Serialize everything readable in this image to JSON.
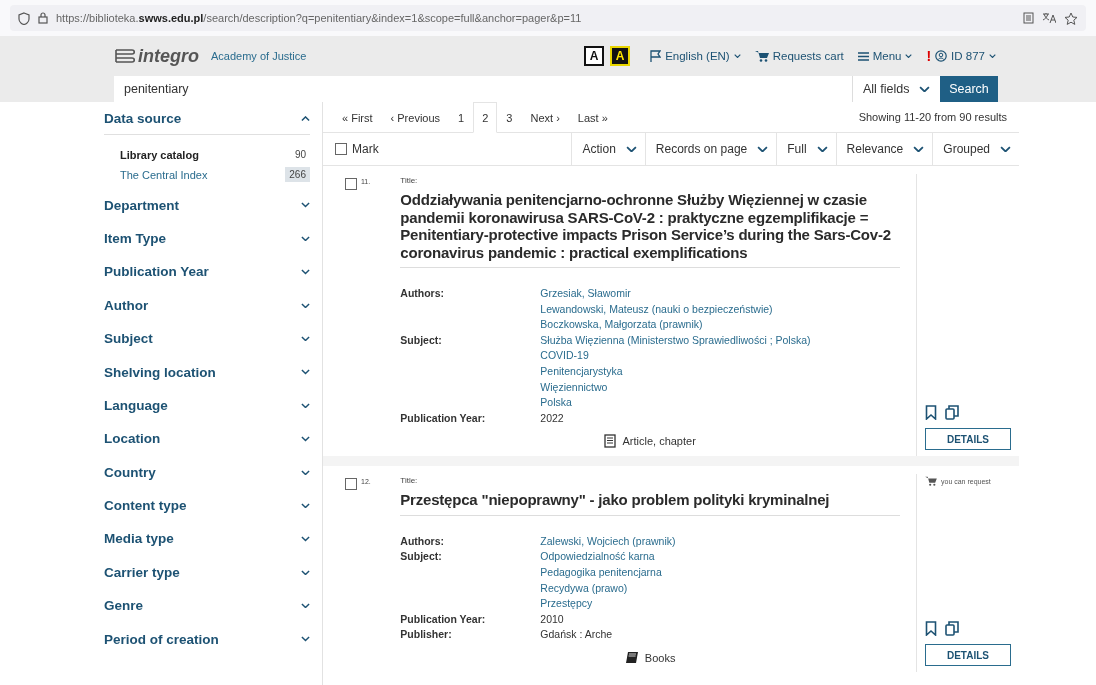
{
  "browser": {
    "url": "https://biblioteka.**swws.edu.pl**/search/description?q=penitentiary&index=1&scope=full&anchor=pager&p=11"
  },
  "header": {
    "logo": "integro",
    "library": "Academy of Justice",
    "contrast": [
      {
        "label": "A",
        "kind": "normal"
      },
      {
        "label": "A",
        "kind": "high"
      }
    ],
    "language": "English (EN)",
    "cart": "Requests cart",
    "menu": "Menu",
    "alert": "!",
    "user": "ID 877"
  },
  "search": {
    "value": "penitentiary",
    "scope": "All fields",
    "button": "Search"
  },
  "facets": [
    {
      "title": "Data source",
      "expanded": true,
      "items": [
        {
          "label": "Library catalog",
          "count": "90",
          "selected": true
        },
        {
          "label": "The Central Index",
          "count": "266",
          "selected": false
        }
      ]
    },
    {
      "title": "Department",
      "expanded": false
    },
    {
      "title": "Item Type",
      "expanded": false
    },
    {
      "title": "Publication Year",
      "expanded": false
    },
    {
      "title": "Author",
      "expanded": false
    },
    {
      "title": "Subject",
      "expanded": false
    },
    {
      "title": "Shelving location",
      "expanded": false
    },
    {
      "title": "Language",
      "expanded": false
    },
    {
      "title": "Location",
      "expanded": false
    },
    {
      "title": "Country",
      "expanded": false
    },
    {
      "title": "Content type",
      "expanded": false
    },
    {
      "title": "Media type",
      "expanded": false
    },
    {
      "title": "Carrier type",
      "expanded": false
    },
    {
      "title": "Genre",
      "expanded": false
    },
    {
      "title": "Period of creation",
      "expanded": false
    }
  ],
  "pager": {
    "items": [
      {
        "label": "« First",
        "selected": false
      },
      {
        "label": "‹ Previous",
        "selected": false
      },
      {
        "label": "1",
        "selected": false
      },
      {
        "label": "2",
        "selected": true
      },
      {
        "label": "3",
        "selected": false
      },
      {
        "label": "Next ›",
        "selected": false
      },
      {
        "label": "Last »",
        "selected": false
      }
    ],
    "summary": "Showing 11-20 from 90 results"
  },
  "toolbar": {
    "mark": {
      "label": "Mark",
      "checked": false
    },
    "dropdowns": [
      "Action",
      "Records on page",
      "Full",
      "Relevance",
      "Grouped"
    ]
  },
  "records": [
    {
      "number": "11.",
      "checked": false,
      "title_label": "Title:",
      "title": "Oddziaływania penitencjarno-ochronne Służby Więziennej w czasie pandemii koronawirusa SARS-CoV-2 : praktyczne egzemplifikacje = Penitentiary-protective impacts Prison Service’s during the Sars-Cov-2 coronavirus pandemic : practical exemplifications",
      "fields": [
        {
          "label": "Authors:",
          "kind": "link",
          "values": [
            "Grzesiak, Sławomir",
            "Lewandowski, Mateusz (nauki o bezpieczeństwie)",
            "Boczkowska, Małgorzata (prawnik)"
          ]
        },
        {
          "label": "Subject:",
          "kind": "link",
          "values": [
            "Służba Więzienna (Ministerstwo Sprawiedliwości ; Polska)",
            "COVID-19",
            "Penitencjarystyka",
            "Więziennictwo",
            "Polska"
          ]
        },
        {
          "label": "Publication Year:",
          "kind": "text",
          "values": [
            "2022"
          ]
        }
      ],
      "format": {
        "label": "Article, chapter",
        "kind": "article"
      },
      "details": "DETAILS"
    },
    {
      "number": "12.",
      "checked": false,
      "title_label": "Title:",
      "title": "Przestępca \"niepoprawny\" - jako problem polityki kryminalnej",
      "request": "you can request",
      "fields": [
        {
          "label": "Authors:",
          "kind": "link",
          "values": [
            "Zalewski, Wojciech (prawnik)"
          ]
        },
        {
          "label": "Subject:",
          "kind": "link",
          "values": [
            "Odpowiedzialność karna",
            "Pedagogika penitencjarna",
            "Recydywa (prawo)",
            "Przestępcy"
          ]
        },
        {
          "label": "Publication Year:",
          "kind": "text",
          "values": [
            "2010"
          ]
        },
        {
          "label": "Publisher:",
          "kind": "text",
          "values": [
            "Gdańsk : Arche"
          ]
        }
      ],
      "format": {
        "label": "Books",
        "kind": "book"
      },
      "details": "DETAILS"
    }
  ]
}
